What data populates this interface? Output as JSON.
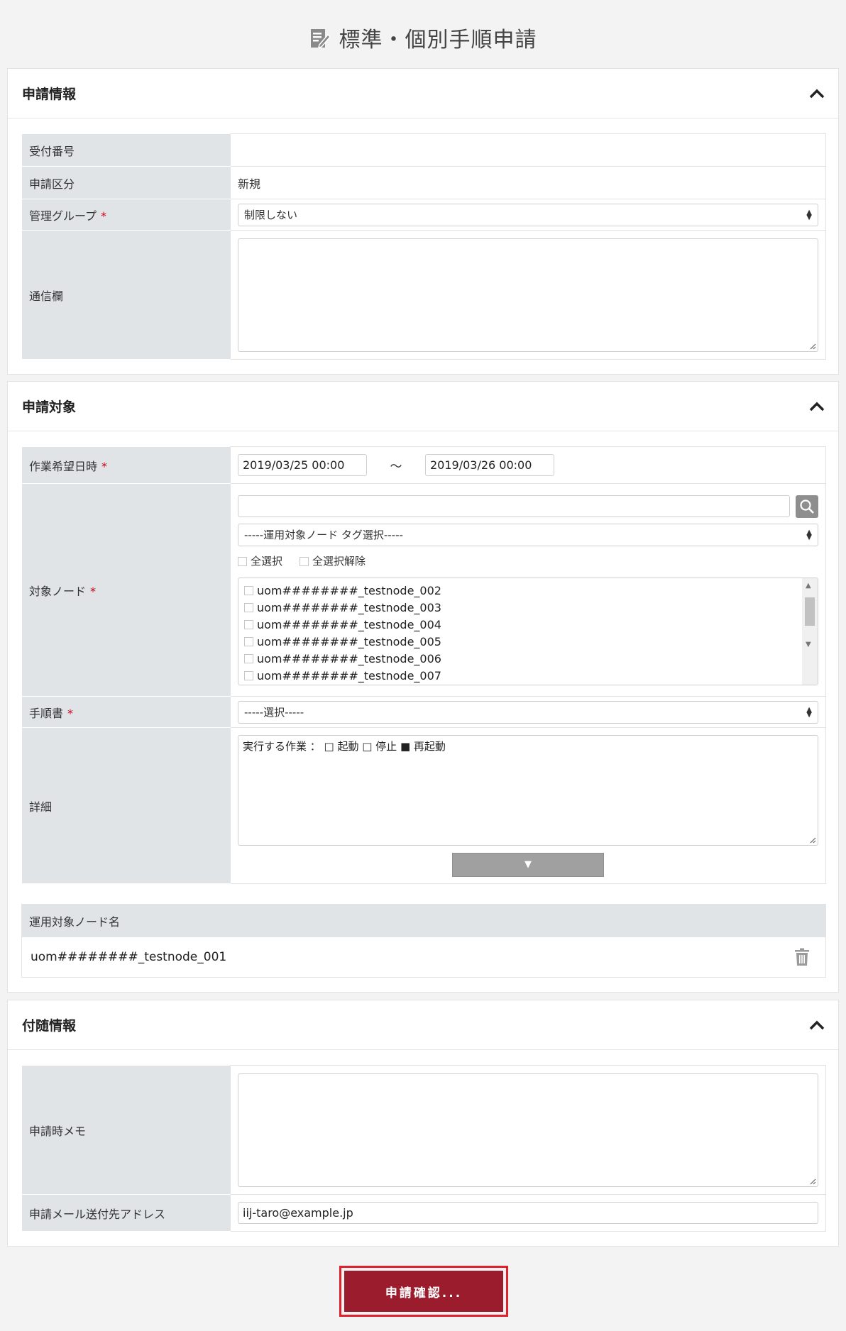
{
  "page": {
    "title": "標準・個別手順申請",
    "title_icon": "edit-document-icon"
  },
  "sections": {
    "application_info": {
      "title": "申請情報",
      "fields": {
        "reception_number_label": "受付番号",
        "reception_number_value": "",
        "application_type_label": "申請区分",
        "application_type_value": "新規",
        "management_group_label": "管理グループ",
        "management_group_value": "制限しない",
        "notes_label": "通信欄",
        "notes_value": ""
      }
    },
    "application_target": {
      "title": "申請対象",
      "fields": {
        "desired_datetime_label": "作業希望日時",
        "datetime_from": "2019/03/25 00:00",
        "datetime_separator": "〜",
        "datetime_to": "2019/03/26 00:00",
        "target_node_label": "対象ノード",
        "node_search_value": "",
        "tag_select_value": "-----運用対象ノード タグ選択-----",
        "select_all_label": "全選択",
        "deselect_all_label": "全選択解除",
        "node_options": [
          "uom########_testnode_002",
          "uom########_testnode_003",
          "uom########_testnode_004",
          "uom########_testnode_005",
          "uom########_testnode_006",
          "uom########_testnode_007"
        ],
        "procedure_label": "手順書",
        "procedure_value": "-----選択-----",
        "details_label": "詳細",
        "details_value": "実行する作業 ： □ 起動 □ 停止 ■ 再起動",
        "expand_glyph": "▼"
      },
      "node_table": {
        "header": "運用対象ノード名",
        "rows": [
          "uom########_testnode_001"
        ]
      }
    },
    "additional_info": {
      "title": "付随情報",
      "fields": {
        "memo_label": "申請時メモ",
        "memo_value": "",
        "mail_label": "申請メール送付先アドレス",
        "mail_value": "iij-taro@example.jp"
      }
    }
  },
  "required_mark": "*",
  "submit_label": "申請確認...",
  "colors": {
    "accent": "#9b1c2c",
    "highlight_border": "#e0222e",
    "required": "#d0021b",
    "label_bg": "#e0e4e7"
  }
}
